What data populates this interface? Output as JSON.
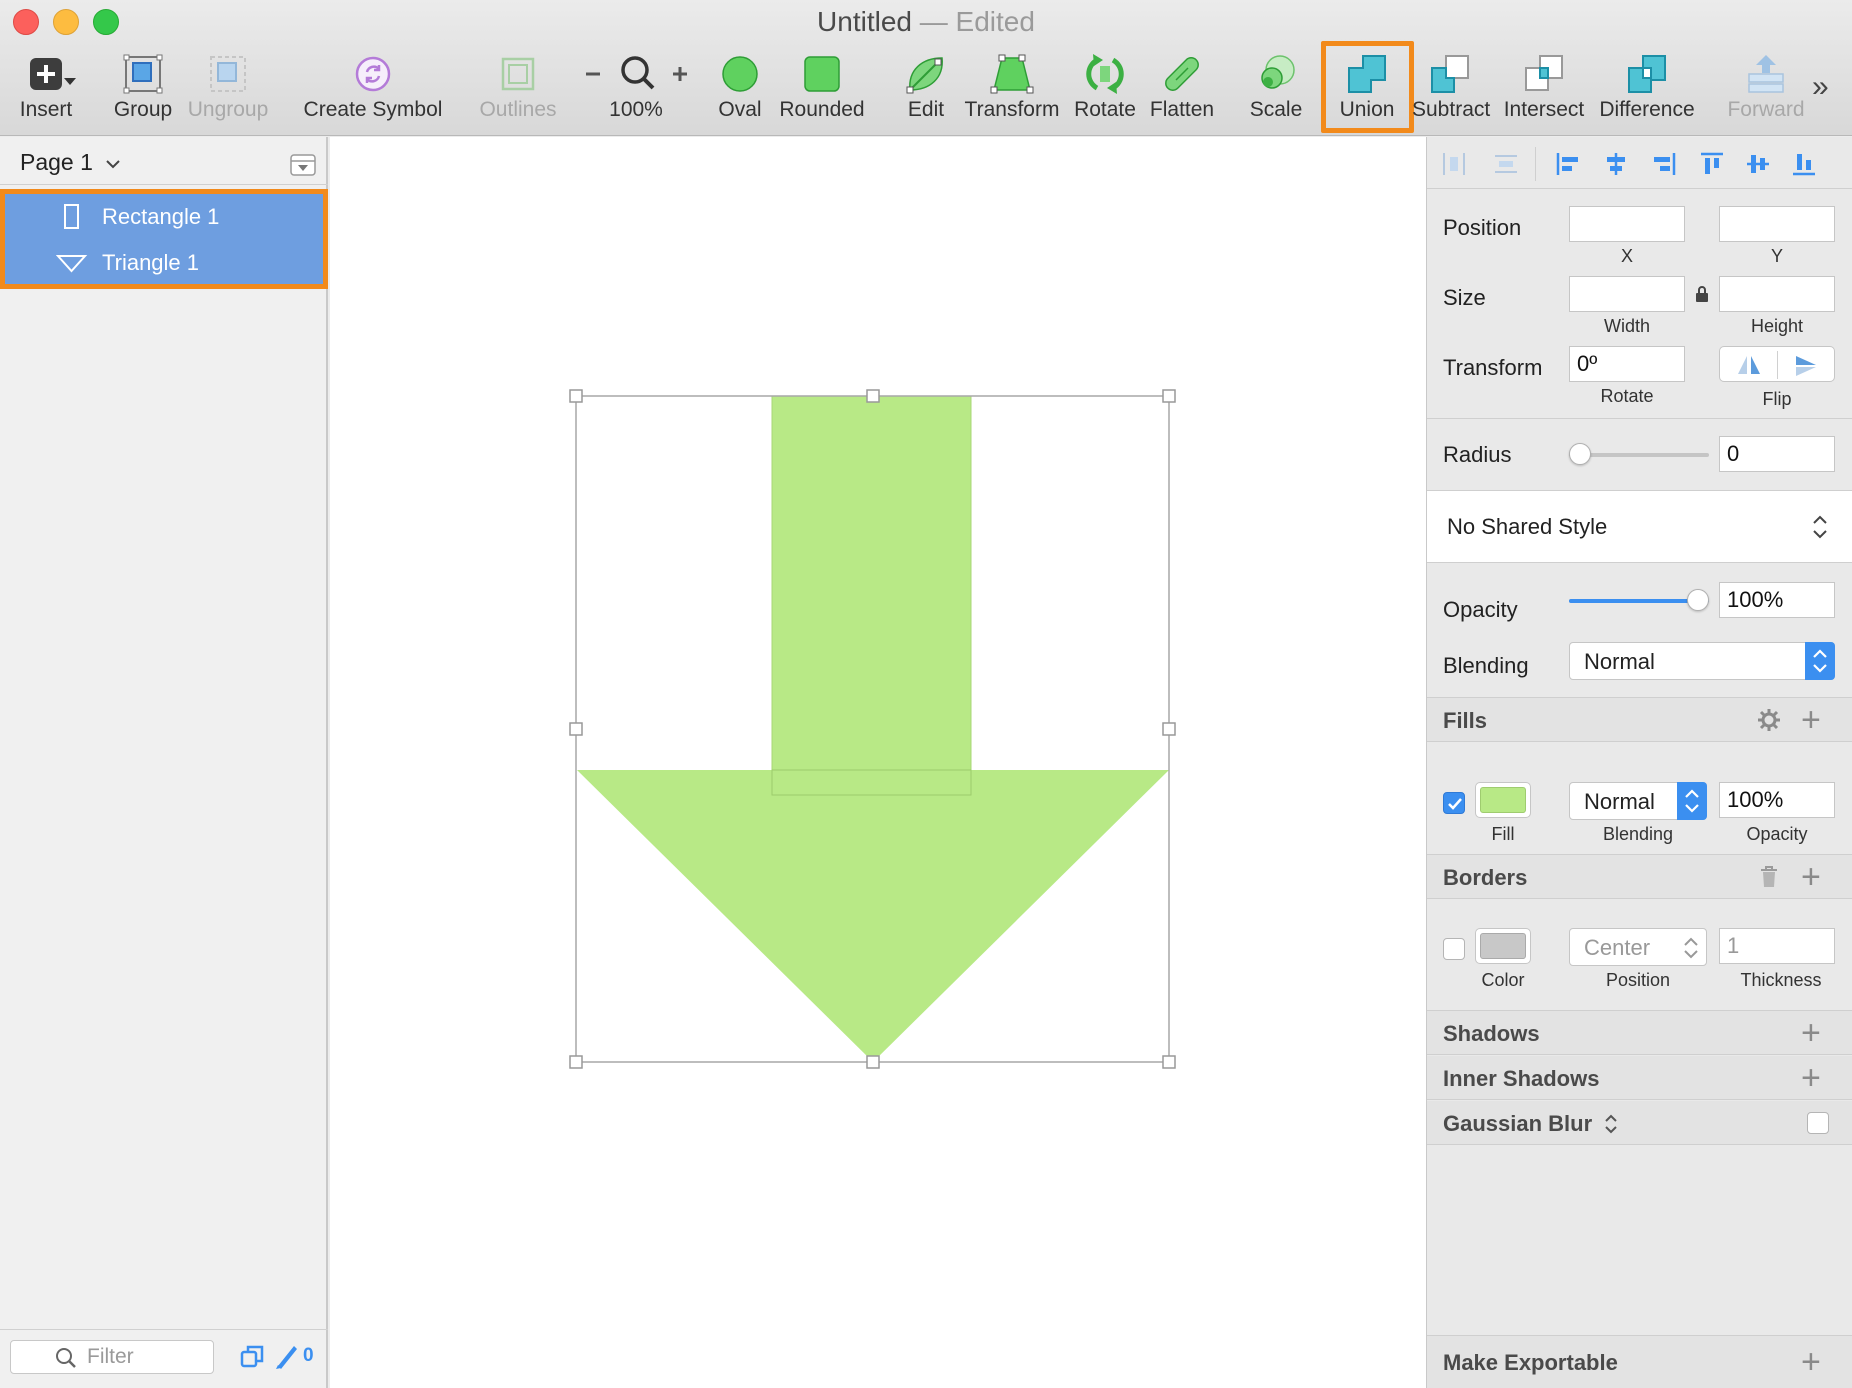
{
  "window": {
    "title": "Untitled",
    "separator": "—",
    "status": "Edited"
  },
  "toolbar": [
    {
      "id": "insert",
      "label": "Insert",
      "icon": "insert-icon",
      "disabled": false
    },
    {
      "id": "group",
      "label": "Group",
      "icon": "group-icon",
      "disabled": false
    },
    {
      "id": "ungroup",
      "label": "Ungroup",
      "icon": "ungroup-icon",
      "disabled": true
    },
    {
      "id": "create-symbol",
      "label": "Create Symbol",
      "icon": "symbol-icon",
      "disabled": false
    },
    {
      "id": "outlines",
      "label": "Outlines",
      "icon": "outlines-icon",
      "disabled": true
    },
    {
      "id": "zoom",
      "label": "100%",
      "icon": "zoom-icon",
      "disabled": false
    },
    {
      "id": "oval",
      "label": "Oval",
      "icon": "oval-icon",
      "disabled": false
    },
    {
      "id": "rounded",
      "label": "Rounded",
      "icon": "rounded-rect-icon",
      "disabled": false
    },
    {
      "id": "edit",
      "label": "Edit",
      "icon": "edit-icon",
      "disabled": false
    },
    {
      "id": "transform",
      "label": "Transform",
      "icon": "transform-icon",
      "disabled": false
    },
    {
      "id": "rotate",
      "label": "Rotate",
      "icon": "rotate-icon",
      "disabled": false
    },
    {
      "id": "flatten",
      "label": "Flatten",
      "icon": "flatten-icon",
      "disabled": false
    },
    {
      "id": "scale",
      "label": "Scale",
      "icon": "scale-icon",
      "disabled": false
    },
    {
      "id": "union",
      "label": "Union",
      "icon": "union-icon",
      "disabled": false,
      "highlighted": true
    },
    {
      "id": "subtract",
      "label": "Subtract",
      "icon": "subtract-icon",
      "disabled": false
    },
    {
      "id": "intersect",
      "label": "Intersect",
      "icon": "intersect-icon",
      "disabled": false
    },
    {
      "id": "difference",
      "label": "Difference",
      "icon": "difference-icon",
      "disabled": false
    },
    {
      "id": "forward",
      "label": "Forward",
      "icon": "forward-icon",
      "disabled": true
    }
  ],
  "toolbar_overflow": "»",
  "sidebar": {
    "page": "Page 1",
    "layers": [
      {
        "name": "Rectangle 1",
        "icon": "rectangle-icon"
      },
      {
        "name": "Triangle 1",
        "icon": "triangle-icon"
      }
    ],
    "filter_placeholder": "Filter",
    "edited_count": "0"
  },
  "inspector": {
    "position": {
      "label": "Position",
      "x": "",
      "y": "",
      "x_cap": "X",
      "y_cap": "Y"
    },
    "size": {
      "label": "Size",
      "width": "",
      "height": "",
      "w_cap": "Width",
      "h_cap": "Height"
    },
    "transform": {
      "label": "Transform",
      "rotate": "0º",
      "rotate_cap": "Rotate",
      "flip_cap": "Flip"
    },
    "radius": {
      "label": "Radius",
      "value": "0",
      "slider_fraction": 0
    },
    "shared_style": "No Shared Style",
    "opacity": {
      "label": "Opacity",
      "value": "100%",
      "slider_fraction": 1
    },
    "blending": {
      "label": "Blending",
      "value": "Normal"
    },
    "fills": {
      "title": "Fills",
      "enabled": true,
      "color": "#b8e986",
      "blending": "Normal",
      "opacity": "100%",
      "fill_cap": "Fill",
      "blend_cap": "Blending",
      "op_cap": "Opacity"
    },
    "borders": {
      "title": "Borders",
      "enabled": false,
      "color": "#c8c8c8",
      "position": "Center",
      "thickness": "1",
      "color_cap": "Color",
      "pos_cap": "Position",
      "th_cap": "Thickness"
    },
    "shadows": "Shadows",
    "inner_shadows": "Inner Shadows",
    "gaussian_blur": "Gaussian Blur",
    "make_exportable": "Make Exportable"
  },
  "colors": {
    "shape_fill": "#b8e986",
    "selection_bg": "#6e9ee0",
    "highlight": "#f28a1b",
    "accent": "#3b8ff0"
  }
}
